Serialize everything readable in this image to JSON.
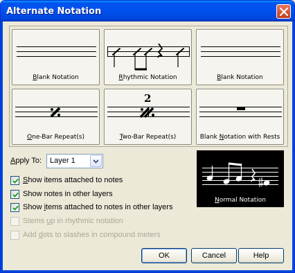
{
  "window": {
    "title": "Alternate Notation",
    "title_bar_color": "#0054e3"
  },
  "notation_buttons": [
    {
      "pre": "",
      "key": "B",
      "post": "lank Notation"
    },
    {
      "pre": "",
      "key": "R",
      "post": "hythmic Notation"
    },
    {
      "pre": "",
      "key": "B",
      "post": "lank Notation"
    },
    {
      "pre": "",
      "key": "O",
      "post": "ne-Bar Repeat(s)"
    },
    {
      "pre": "",
      "key": "T",
      "post": "wo-Bar Repeat(s)"
    },
    {
      "pre": "Blank ",
      "key": "N",
      "post": "otation with Rests"
    }
  ],
  "two_bar_number": "2",
  "apply_to": {
    "pre": "",
    "key": "A",
    "post": "pply To:",
    "value": "Layer 1"
  },
  "checkboxes": [
    {
      "pre": "",
      "key": "S",
      "post": "how items attached to notes",
      "checked": true,
      "enabled": true
    },
    {
      "pre": "Show notes in other layers",
      "key": "",
      "post": "",
      "checked": true,
      "enabled": true
    },
    {
      "pre": "Show ",
      "key": "i",
      "post": "tems attached to notes in other layers",
      "checked": true,
      "enabled": true
    },
    {
      "pre": "Stems ",
      "key": "u",
      "post": "p in rhythmic notation",
      "checked": false,
      "enabled": false
    },
    {
      "pre": "Add ",
      "key": "d",
      "post": "ots to slashes in compound meters",
      "checked": false,
      "enabled": false
    }
  ],
  "preview": {
    "pre": "",
    "key": "N",
    "post": "ormal Notation",
    "background": "#000000"
  },
  "buttons": {
    "ok": "OK",
    "cancel": "Cancel",
    "help": "Help"
  }
}
